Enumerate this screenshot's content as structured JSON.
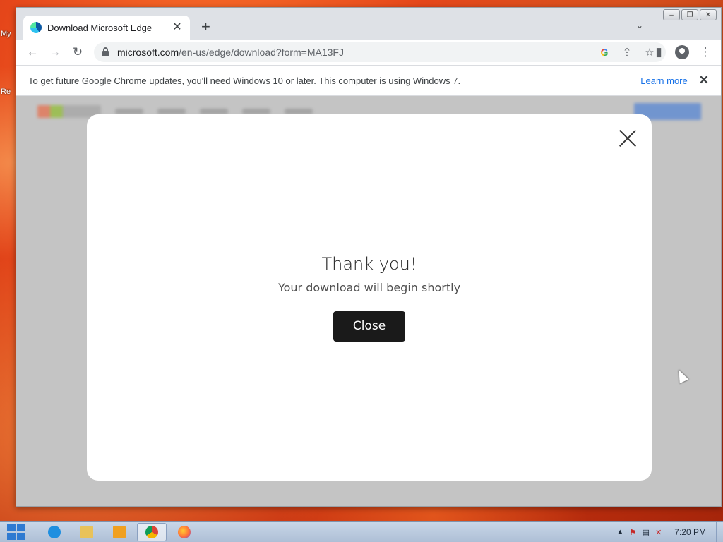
{
  "desktop": {
    "labels": [
      "My",
      "Re"
    ]
  },
  "browser": {
    "tab": {
      "title": "Download Microsoft Edge",
      "close": "✕"
    },
    "new_tab": "+",
    "tab_menu": "⌄",
    "window_controls": {
      "minimize": "–",
      "restore": "❐",
      "close": "✕"
    },
    "toolbar": {
      "back": "←",
      "forward": "→",
      "reload": "↻",
      "url_host": "microsoft.com",
      "url_path": "/en-us/edge/download?form=MA13FJ",
      "google_icon": "G",
      "share_icon": "⇪",
      "bookmark_icon": "☆",
      "sidepanel_icon": "▮",
      "menu_icon": "⋮"
    },
    "infobar": {
      "message": "To get future Google Chrome updates, you'll need Windows 10 or later. This computer is using Windows 7.",
      "learn_more": "Learn more",
      "close": "✕"
    }
  },
  "modal": {
    "title": "Thank you!",
    "subtitle": "Your download will begin shortly",
    "close_button": "Close"
  },
  "taskbar": {
    "clock": "7:20 PM",
    "tray_expand": "▲",
    "tray_icons": [
      "⚑",
      "▤",
      "✕"
    ],
    "apps": [
      {
        "name": "internet-explorer",
        "color": "#1e8fe0"
      },
      {
        "name": "file-explorer",
        "color": "#e8c25a"
      },
      {
        "name": "media-player",
        "color": "#f0a020"
      },
      {
        "name": "chrome",
        "color": "#db4437"
      },
      {
        "name": "firefox",
        "color": "#ff7139"
      }
    ]
  },
  "colors": {
    "accent_link": "#1a73e8",
    "modal_button": "#1a1a1a"
  }
}
